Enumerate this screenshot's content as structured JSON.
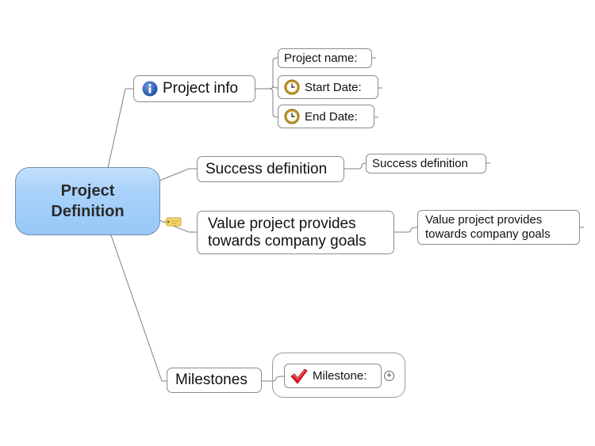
{
  "map": {
    "central_topic": {
      "line1": "Project",
      "line2": "Definition"
    },
    "topics": [
      {
        "label": "Project info",
        "icon": "info-icon",
        "subtopics": [
          {
            "label": "Project name:",
            "icon": null
          },
          {
            "label": "Start Date:",
            "icon": "clock-icon"
          },
          {
            "label": "End Date:",
            "icon": "clock-icon"
          }
        ]
      },
      {
        "label": "Success definition",
        "icon": null,
        "subtopics": [
          {
            "label": "Success definition",
            "icon": null
          }
        ]
      },
      {
        "label_line1": "Value project provides",
        "label_line2": "towards company goals",
        "icon": null,
        "marker": "label-tag-icon",
        "subtopics": [
          {
            "label_line1": "Value project provides",
            "label_line2": "towards company goals",
            "icon": null
          }
        ]
      },
      {
        "label": "Milestones",
        "icon": null,
        "subtopics": [
          {
            "label": "Milestone:",
            "icon": "checkmark-icon",
            "expand": "+"
          }
        ]
      }
    ]
  },
  "colors": {
    "central_fill": "#a9d2fa",
    "central_border": "#6f8fae",
    "node_border": "#8c8c8c",
    "connector": "#808080",
    "info_blue": "#2f62b4",
    "clock_gold": "#b8902a",
    "check_red": "#e0191e",
    "tag_yellow": "#f2d86a"
  }
}
